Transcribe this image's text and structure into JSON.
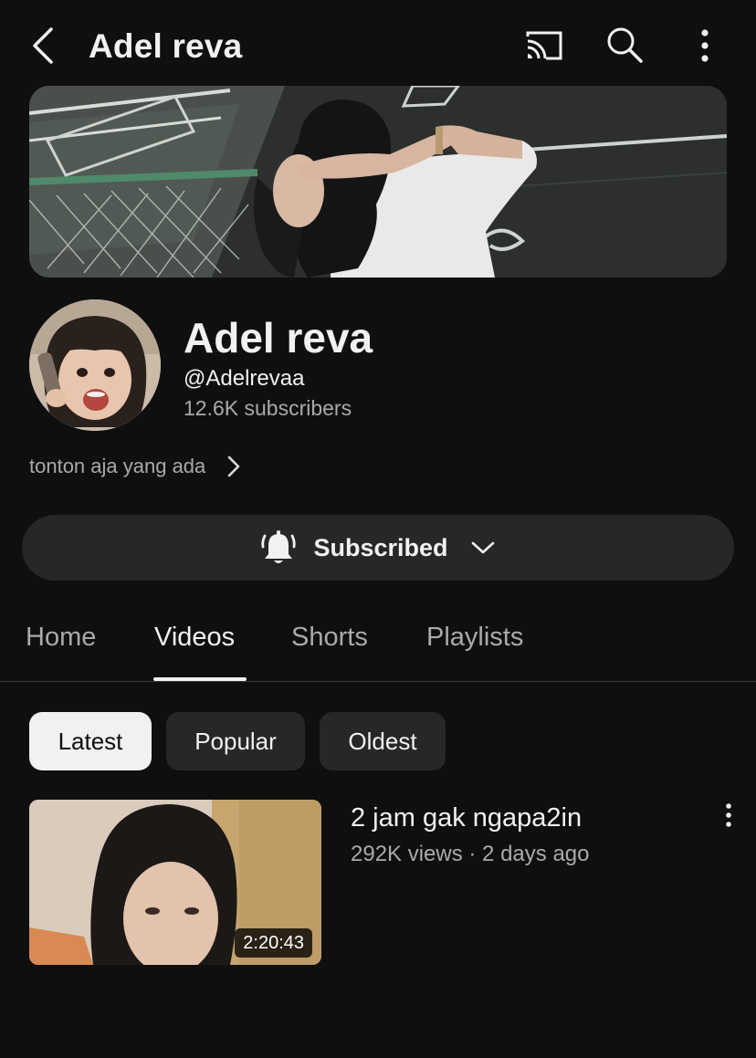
{
  "topbar": {
    "title": "Adel reva",
    "icons": {
      "back": "back-chevron-icon",
      "cast": "cast-icon",
      "search": "search-icon",
      "more": "more-vert-icon"
    }
  },
  "channel": {
    "name": "Adel reva",
    "handle": "@Adelrevaa",
    "subscribers": "12.6K subscribers",
    "description": "tonton aja yang ada"
  },
  "subscribe": {
    "label": "Subscribed",
    "icon": "bell-ring-icon"
  },
  "tabs": [
    {
      "label": "Home",
      "active": false
    },
    {
      "label": "Videos",
      "active": true
    },
    {
      "label": "Shorts",
      "active": false
    },
    {
      "label": "Playlists",
      "active": false
    }
  ],
  "chips": [
    {
      "label": "Latest",
      "selected": true
    },
    {
      "label": "Popular",
      "selected": false
    },
    {
      "label": "Oldest",
      "selected": false
    }
  ],
  "videos": [
    {
      "title": "2 jam gak ngapa2in",
      "meta": "292K views · 2 days ago",
      "duration": "2:20:43"
    }
  ],
  "colors": {
    "background": "#0f0f0f",
    "surface": "#272727",
    "text": "#f1f1f1",
    "secondary_text": "#aaaaaa"
  }
}
